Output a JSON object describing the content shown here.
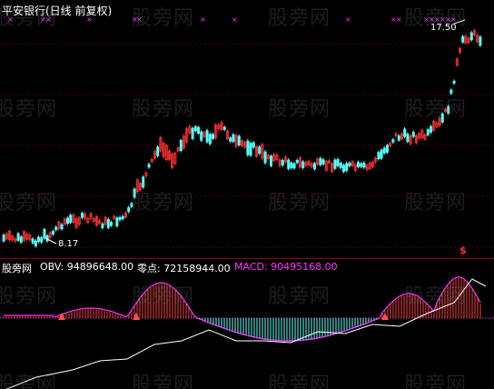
{
  "window": {
    "title": "平安银行(日线 前复权)"
  },
  "watermark": "股旁网",
  "price_panel": {
    "high_label": "17.50",
    "low_label": "8.17",
    "colors": {
      "up": "#ff3333",
      "down": "#55ffff",
      "grid": "#8a0000",
      "marker": "#ff33ff"
    }
  },
  "indicator": {
    "name": "股旁网",
    "obv_label": "OBV: 94896648.00",
    "zero_label": "零点: 72158944.00",
    "macd_label": "MACD: 90495168.00",
    "colors": {
      "obv": "#ffffff",
      "macd": "#ff33ff",
      "pos": "#ff4040",
      "neg": "#66ffff"
    }
  },
  "signal_marker": "$"
}
